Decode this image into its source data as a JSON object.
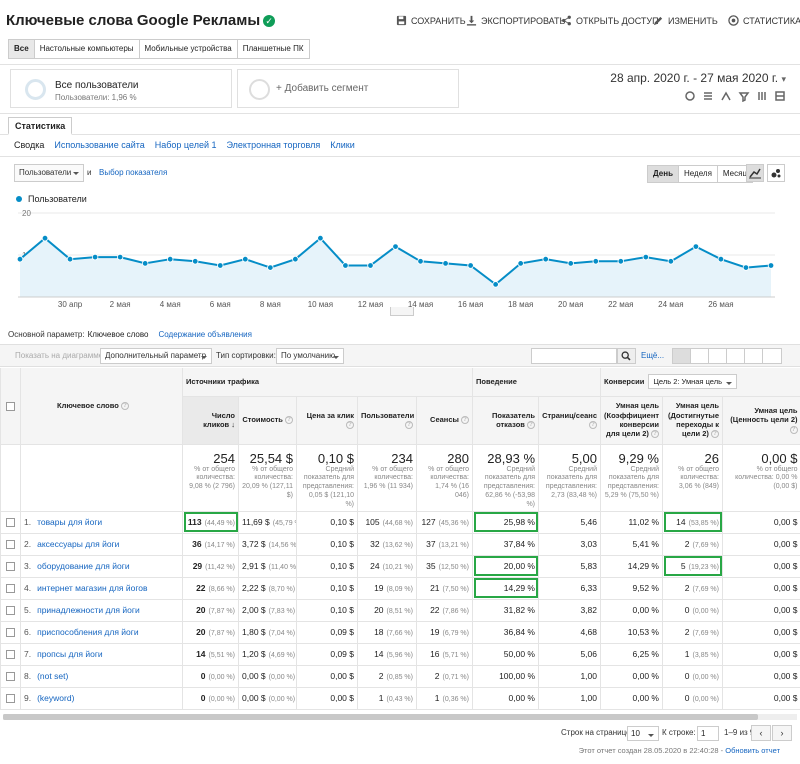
{
  "header": {
    "title": "Ключевые слова Google Рекламы",
    "actions": [
      "СОХРАНИТЬ",
      "ЭКСПОРТИРОВАТЬ",
      "ОТКРЫТЬ ДОСТУП",
      "ИЗМЕНИТЬ",
      "СТАТИСТИКА"
    ]
  },
  "device_tabs": [
    "Все",
    "Настольные компьютеры",
    "Мобильные устройства",
    "Планшетные ПК"
  ],
  "segments": {
    "active_title": "Все пользователи",
    "active_sub": "Пользователи: 1,96 %",
    "add": "+ Добавить сегмент"
  },
  "date_range": "28 апр. 2020 г. - 27 мая 2020 г.",
  "stats_tab": "Статистика",
  "subtabs": [
    "Сводка",
    "Использование сайта",
    "Набор целей 1",
    "Электронная торговля",
    "Клики"
  ],
  "chart_controls": {
    "metric": "Пользователи",
    "and": "и",
    "choose_metric": "Выбор показателя",
    "periods": [
      "День",
      "Неделя",
      "Месяц"
    ]
  },
  "chart_data": {
    "type": "area",
    "series": [
      {
        "name": "Пользователи",
        "values": [
          9,
          14,
          9,
          9.5,
          9.5,
          8,
          9,
          8.5,
          7.5,
          9,
          7,
          9,
          14,
          7.5,
          7.5,
          12,
          8.5,
          8,
          7.5,
          3,
          8,
          9,
          8,
          8.5,
          8.5,
          9.5,
          8.5,
          12,
          9,
          7,
          7.5
        ]
      }
    ],
    "y_ticks": [
      "20",
      "10"
    ],
    "ylim": [
      0,
      20
    ],
    "x_tick_labels": [
      "30 апр",
      "2 мая",
      "4 мая",
      "6 мая",
      "8 мая",
      "10 мая",
      "12 мая",
      "14 мая",
      "16 мая",
      "18 мая",
      "20 мая",
      "22 мая",
      "24 мая",
      "26 мая"
    ],
    "color": "#058dc7"
  },
  "primary_dimension": {
    "label": "Основной параметр:",
    "active": "Ключевое слово",
    "other": "Содержание объявления"
  },
  "table_toolbar": {
    "plot_rows": "Показать на диаграмме",
    "secondary_dim": "Дополнительный параметр",
    "sort_label": "Тип сортировки:",
    "sort_value": "По умолчанию",
    "more": "Ещё..."
  },
  "table": {
    "group_headers": {
      "acquisition": "Источники трафика",
      "behavior": "Поведение",
      "conversions": "Конверсии",
      "goal_select": "Цель 2: Умная цель"
    },
    "col_keyword": "Ключевое слово",
    "columns": [
      "Число кликов",
      "Стоимость",
      "Цена за клик",
      "Пользователи",
      "Сеансы",
      "Показатель отказов",
      "Страниц/сеанс",
      "Умная цель (Коэффициент конверсии для цели 2)",
      "Умная цель (Достигнутые переходы к цели 2)",
      "Умная цель (Ценность цели 2)"
    ],
    "totals": [
      {
        "value": "254",
        "sub": "% от общего количества: 9,08 % (2 796)"
      },
      {
        "value": "25,54 $",
        "sub": "% от общего количества: 20,09 % (127,11 $)"
      },
      {
        "value": "0,10 $",
        "sub": "Средний показатель для представления: 0,05 $ (121,10 %)"
      },
      {
        "value": "234",
        "sub": "% от общего количества: 1,96 % (11 934)"
      },
      {
        "value": "280",
        "sub": "% от общего количества: 1,74 % (16 046)"
      },
      {
        "value": "28,93 %",
        "sub": "Средний показатель для представления: 62,86 % (-53,98 %)"
      },
      {
        "value": "5,00",
        "sub": "Средний показатель для представления: 2,73 (83,48 %)"
      },
      {
        "value": "9,29 %",
        "sub": "Средний показатель для представления: 5,29 % (75,50 %)"
      },
      {
        "value": "26",
        "sub": "% от общего количества: 3,06 % (849)"
      },
      {
        "value": "0,00 $",
        "sub": "% от общего количества: 0,00 % (0,00 $)"
      }
    ],
    "rows": [
      {
        "idx": "1.",
        "keyword": "товары для йоги",
        "clicks": "113",
        "clicks_pct": "(44,49 %)",
        "cost": "11,69 $",
        "cost_pct": "(45,79 %)",
        "cpc": "0,10 $",
        "users": "105",
        "users_pct": "(44,68 %)",
        "sessions": "127",
        "sessions_pct": "(45,36 %)",
        "bounce": "25,98 %",
        "pages": "5,46",
        "conv": "11,02 %",
        "goal": "14",
        "goal_pct": "(53,85 %)",
        "value": "0,00 $"
      },
      {
        "idx": "2.",
        "keyword": "аксессуары для йоги",
        "clicks": "36",
        "clicks_pct": "(14,17 %)",
        "cost": "3,72 $",
        "cost_pct": "(14,56 %)",
        "cpc": "0,10 $",
        "users": "32",
        "users_pct": "(13,62 %)",
        "sessions": "37",
        "sessions_pct": "(13,21 %)",
        "bounce": "37,84 %",
        "pages": "3,03",
        "conv": "5,41 %",
        "goal": "2",
        "goal_pct": "(7,69 %)",
        "value": "0,00 $"
      },
      {
        "idx": "3.",
        "keyword": "оборудование для йоги",
        "clicks": "29",
        "clicks_pct": "(11,42 %)",
        "cost": "2,91 $",
        "cost_pct": "(11,40 %)",
        "cpc": "0,10 $",
        "users": "24",
        "users_pct": "(10,21 %)",
        "sessions": "35",
        "sessions_pct": "(12,50 %)",
        "bounce": "20,00 %",
        "pages": "5,83",
        "conv": "14,29 %",
        "goal": "5",
        "goal_pct": "(19,23 %)",
        "value": "0,00 $"
      },
      {
        "idx": "4.",
        "keyword": "интернет магазин для йогов",
        "clicks": "22",
        "clicks_pct": "(8,66 %)",
        "cost": "2,22 $",
        "cost_pct": "(8,70 %)",
        "cpc": "0,10 $",
        "users": "19",
        "users_pct": "(8,09 %)",
        "sessions": "21",
        "sessions_pct": "(7,50 %)",
        "bounce": "14,29 %",
        "pages": "6,33",
        "conv": "9,52 %",
        "goal": "2",
        "goal_pct": "(7,69 %)",
        "value": "0,00 $"
      },
      {
        "idx": "5.",
        "keyword": "принадлежности для йоги",
        "clicks": "20",
        "clicks_pct": "(7,87 %)",
        "cost": "2,00 $",
        "cost_pct": "(7,83 %)",
        "cpc": "0,10 $",
        "users": "20",
        "users_pct": "(8,51 %)",
        "sessions": "22",
        "sessions_pct": "(7,86 %)",
        "bounce": "31,82 %",
        "pages": "3,82",
        "conv": "0,00 %",
        "goal": "0",
        "goal_pct": "(0,00 %)",
        "value": "0,00 $"
      },
      {
        "idx": "6.",
        "keyword": "приспособления для йоги",
        "clicks": "20",
        "clicks_pct": "(7,87 %)",
        "cost": "1,80 $",
        "cost_pct": "(7,04 %)",
        "cpc": "0,09 $",
        "users": "18",
        "users_pct": "(7,66 %)",
        "sessions": "19",
        "sessions_pct": "(6,79 %)",
        "bounce": "36,84 %",
        "pages": "4,68",
        "conv": "10,53 %",
        "goal": "2",
        "goal_pct": "(7,69 %)",
        "value": "0,00 $"
      },
      {
        "idx": "7.",
        "keyword": "пропсы для йоги",
        "clicks": "14",
        "clicks_pct": "(5,51 %)",
        "cost": "1,20 $",
        "cost_pct": "(4,69 %)",
        "cpc": "0,09 $",
        "users": "14",
        "users_pct": "(5,96 %)",
        "sessions": "16",
        "sessions_pct": "(5,71 %)",
        "bounce": "50,00 %",
        "pages": "5,06",
        "conv": "6,25 %",
        "goal": "1",
        "goal_pct": "(3,85 %)",
        "value": "0,00 $"
      },
      {
        "idx": "8.",
        "keyword": "(not set)",
        "clicks": "0",
        "clicks_pct": "(0,00 %)",
        "cost": "0,00 $",
        "cost_pct": "(0,00 %)",
        "cpc": "0,00 $",
        "users": "2",
        "users_pct": "(0,85 %)",
        "sessions": "2",
        "sessions_pct": "(0,71 %)",
        "bounce": "100,00 %",
        "pages": "1,00",
        "conv": "0,00 %",
        "goal": "0",
        "goal_pct": "(0,00 %)",
        "value": "0,00 $"
      },
      {
        "idx": "9.",
        "keyword": "(keyword)",
        "clicks": "0",
        "clicks_pct": "(0,00 %)",
        "cost": "0,00 $",
        "cost_pct": "(0,00 %)",
        "cpc": "0,00 $",
        "users": "1",
        "users_pct": "(0,43 %)",
        "sessions": "1",
        "sessions_pct": "(0,36 %)",
        "bounce": "0,00 %",
        "pages": "1,00",
        "conv": "0,00 %",
        "goal": "0",
        "goal_pct": "(0,00 %)",
        "value": "0,00 $"
      }
    ]
  },
  "pagination": {
    "rows_label": "Строк на странице:",
    "rows_value": "10",
    "goto_label": "К строке:",
    "goto_value": "1",
    "range": "1–9 из 9"
  },
  "footer": {
    "text": "Этот отчет создан 28.05.2020 в 22:40:28 -",
    "refresh": "Обновить отчет"
  }
}
